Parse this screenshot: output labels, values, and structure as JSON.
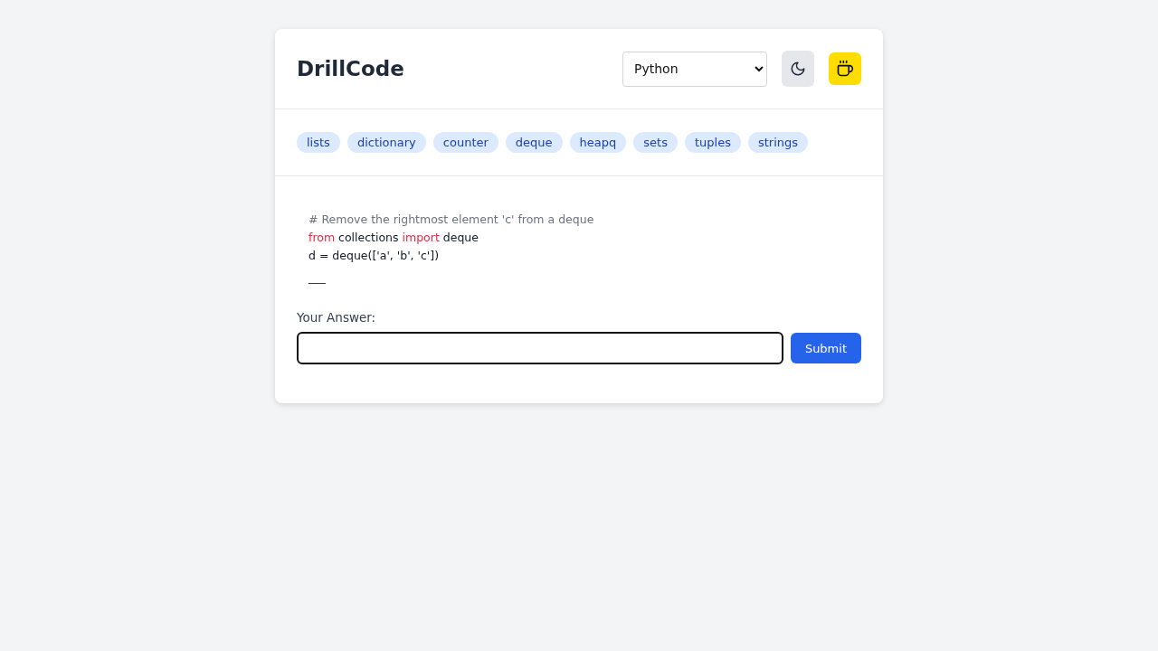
{
  "header": {
    "title": "DrillCode",
    "language": {
      "value": "Python"
    }
  },
  "tags": [
    {
      "label": "lists"
    },
    {
      "label": "dictionary"
    },
    {
      "label": "counter"
    },
    {
      "label": "deque"
    },
    {
      "label": "heapq"
    },
    {
      "label": "sets"
    },
    {
      "label": "tuples"
    },
    {
      "label": "strings"
    }
  ],
  "code": [
    [
      {
        "kind": "comment",
        "text": "# Remove the rightmost element 'c' from a deque"
      }
    ],
    [
      {
        "kind": "keyword",
        "text": "from"
      },
      {
        "kind": "plain",
        "text": " collections "
      },
      {
        "kind": "keyword",
        "text": "import"
      },
      {
        "kind": "plain",
        "text": " deque"
      }
    ],
    [
      {
        "kind": "plain",
        "text": "d = deque(['a', 'b', 'c'])"
      }
    ],
    [
      {
        "kind": "plain",
        "text": "___"
      }
    ]
  ],
  "answer": {
    "label": "Your Answer:",
    "focused": true,
    "submit": "Submit"
  }
}
